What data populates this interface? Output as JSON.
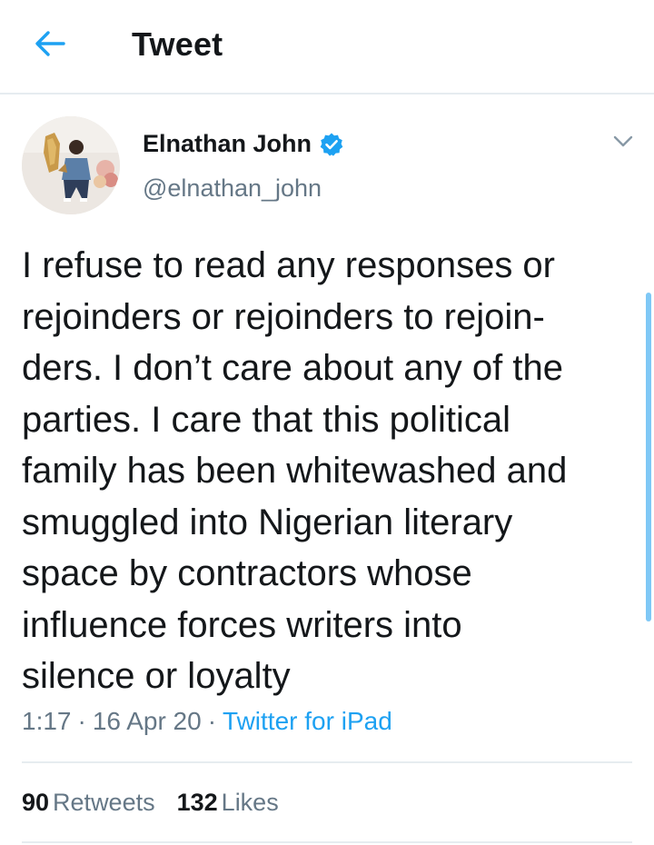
{
  "header": {
    "back_icon": "arrow-left-icon",
    "title": "Tweet"
  },
  "tweet": {
    "author": {
      "name": "Elnathan John",
      "handle": "@elnathan_john",
      "verified_icon": "verified-badge-icon"
    },
    "text": "I refuse to read any responses or\nrejoinders or rejoinders to rejoin-\nders. I don’t care about any of the\nparties. I care that this political\nfamily has been whitewashed and\nsmuggled into Nigerian literary\nspace by contractors whose\ninfluence forces writers into\nsilence or loyalty",
    "time": "1:17",
    "date": "16 Apr 20",
    "separator": "·",
    "source": "Twitter for iPad",
    "retweets_count": "90",
    "retweets_label": "Retweets",
    "likes_count": "132",
    "likes_label": "Likes"
  },
  "colors": {
    "accent": "#1da1f2",
    "secondary_text": "#657786",
    "divider": "#e6ecf0"
  }
}
